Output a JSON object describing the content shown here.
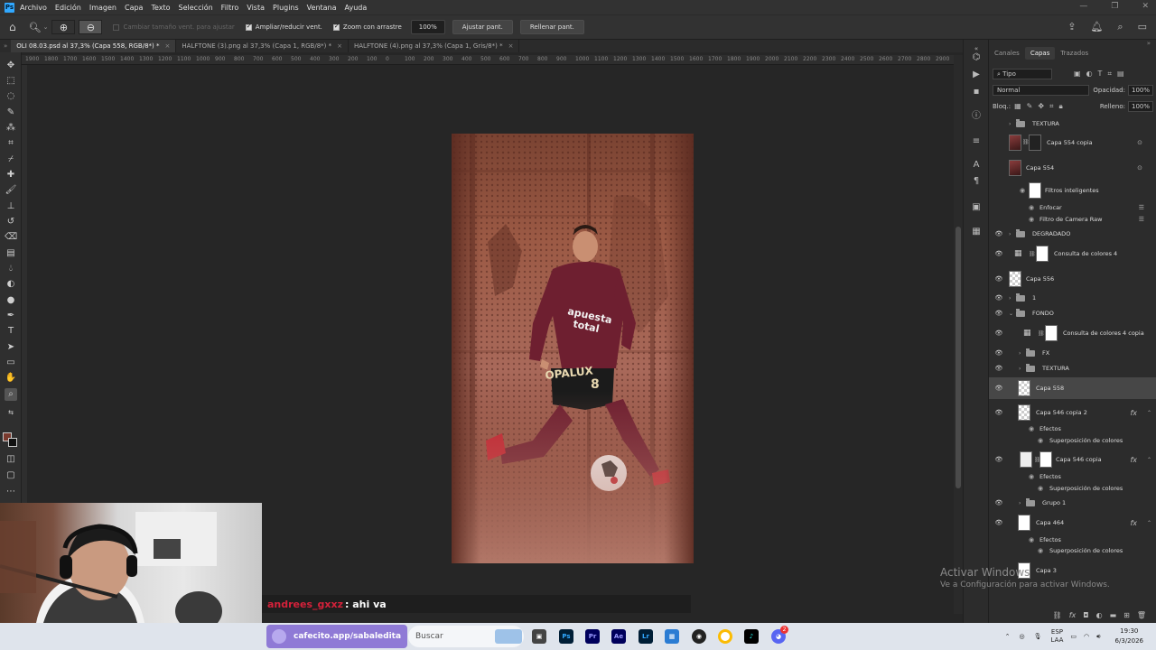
{
  "menubar": {
    "items": [
      "Archivo",
      "Edición",
      "Imagen",
      "Capa",
      "Texto",
      "Selección",
      "Filtro",
      "Vista",
      "Plugins",
      "Ventana",
      "Ayuda"
    ]
  },
  "options": {
    "resize_windows": "Cambiar tamaño vent. para ajustar",
    "zoom_all": "Ampliar/reducir vent.",
    "scrubby_zoom": "Zoom con arrastre",
    "zoom_pct": "100%",
    "fit_screen": "Ajustar pant.",
    "fill_screen": "Rellenar pant."
  },
  "tabs": [
    {
      "label": "OLI 08.03.psd al 37,3% (Capa 558, RGB/8*) *"
    },
    {
      "label": "HALFTONE (3).png al 37,3% (Capa 1, RGB/8*) *"
    },
    {
      "label": "HALFTONE (4).png al 37,3% (Capa 1, Gris/8*) *"
    }
  ],
  "ruler": [
    "1900",
    "1800",
    "1700",
    "1600",
    "1500",
    "1400",
    "1300",
    "1200",
    "1100",
    "1000",
    "900",
    "800",
    "700",
    "600",
    "500",
    "400",
    "300",
    "200",
    "100",
    "0",
    "100",
    "200",
    "300",
    "400",
    "500",
    "600",
    "700",
    "800",
    "900",
    "1000",
    "1100",
    "1200",
    "1300",
    "1400",
    "1500",
    "1600",
    "1700",
    "1800",
    "1900",
    "2000",
    "2100",
    "2200",
    "2300",
    "2400",
    "2500",
    "2600",
    "2700",
    "2800",
    "2900",
    "3000"
  ],
  "panel": {
    "tabs": [
      "Canales",
      "Capas",
      "Trazados"
    ],
    "active_tab": "Capas",
    "filter": "Tipo",
    "blend_mode": "Normal",
    "opacity_label": "Opacidad:",
    "opacity": "100%",
    "lock_label": "Bloq.:",
    "fill_label": "Relleno:",
    "fill": "100%"
  },
  "layers": [
    {
      "name": "TEXTURA"
    },
    {
      "name": "Capa 554 copia"
    },
    {
      "name": "Capa 554"
    },
    {
      "name": "Filtros inteligentes"
    },
    {
      "name": "Enfocar"
    },
    {
      "name": "Filtro de Camera Raw"
    },
    {
      "name": "DEGRADADO"
    },
    {
      "name": "Consulta de colores 4"
    },
    {
      "name": "Capa 556"
    },
    {
      "name": "1"
    },
    {
      "name": "FONDO"
    },
    {
      "name": "Consulta de colores 4 copia"
    },
    {
      "name": "FX"
    },
    {
      "name": "TEXTURA"
    },
    {
      "name": "Capa 558"
    },
    {
      "name": "Capa 546 copia 2"
    },
    {
      "name": "Efectos"
    },
    {
      "name": "Superposición de colores"
    },
    {
      "name": "Capa 546 copia"
    },
    {
      "name": "Efectos"
    },
    {
      "name": "Superposición de colores"
    },
    {
      "name": "Grupo 1"
    },
    {
      "name": "Capa 464"
    },
    {
      "name": "Efectos"
    },
    {
      "name": "Superposición de colores"
    },
    {
      "name": "Capa 3"
    }
  ],
  "fx_label": "fx",
  "artwork": {
    "sponsor": "apuesta total",
    "brand": "OPALUX",
    "number": "8"
  },
  "chat": {
    "user": "andrees_gxxz",
    "message": ": ahi va"
  },
  "activate": {
    "title": "Activar Windows",
    "subtitle": "Ve a Configuración para activar Windows."
  },
  "taskbar": {
    "promo": "cafecito.app/sabaledita",
    "search": "Buscar",
    "lang": "ESP",
    "lang2": "LAA",
    "time": "19:30",
    "date": "6/3/2026",
    "badge": "2"
  },
  "colors": {
    "ps_blue": "#31a8ff",
    "chat_user": "#d4213a",
    "promo": "#8f7ad6"
  }
}
